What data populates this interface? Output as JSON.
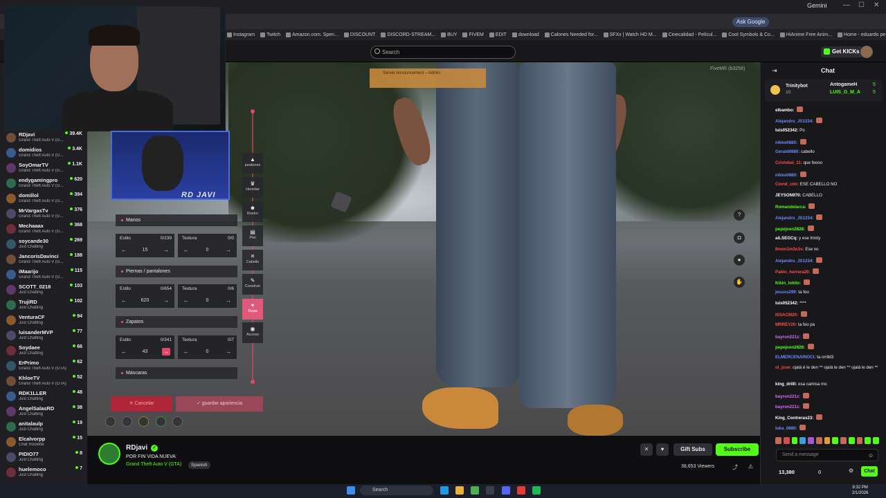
{
  "browser": {
    "gemini_label": "Gemini",
    "ask_google_label": "Ask Google",
    "bookmarks": [
      "Instagram",
      "Twitch",
      "Amazon.com. Spen...",
      "DISCOUNT",
      "DISCORD-STREAM...",
      "BUY",
      "FIVEM",
      "EDIT",
      "download",
      "Calones Needed for...",
      "SFXx | Watch HD M...",
      "Cinecalidad - Películ...",
      "Cool Symbols & Co...",
      "HiAnime Free Anim...",
      "Home - eduardo pe..."
    ]
  },
  "topnav": {
    "search_placeholder": "Search",
    "get_kicks_label": "Get KICKs"
  },
  "sidebar": {
    "channels": [
      {
        "name": "RDjavi",
        "game": "Grand Theft Auto V (G...",
        "viewers": "39.4K"
      },
      {
        "name": "domidios",
        "game": "Grand Theft Auto V (G...",
        "viewers": "3.4K"
      },
      {
        "name": "SoyOmarTV",
        "game": "Grand Theft Auto V (G...",
        "viewers": "1.1K"
      },
      {
        "name": "endygamingpro",
        "game": "Grand Theft Auto V (G...",
        "viewers": "620"
      },
      {
        "name": "domillol",
        "game": "Grand Theft Auto V (G...",
        "viewers": "394"
      },
      {
        "name": "MrVargasTv",
        "game": "Grand Theft Auto V (G...",
        "viewers": "376"
      },
      {
        "name": "Mechaaax",
        "game": "Grand Theft Auto V (G...",
        "viewers": "368"
      },
      {
        "name": "soycande30",
        "game": "Just Chatting",
        "viewers": "269"
      },
      {
        "name": "JancorisDavinci",
        "game": "Grand Theft Auto V (G...",
        "viewers": "188"
      },
      {
        "name": "iMaarijo",
        "game": "Grand Theft Auto V (G...",
        "viewers": "115"
      },
      {
        "name": "SCOTT_0218",
        "game": "Just Chatting",
        "viewers": "103"
      },
      {
        "name": "TrujiRD",
        "game": "Just Chatting",
        "viewers": "102"
      },
      {
        "name": "VenturaCF",
        "game": "Just Chatting",
        "viewers": "94"
      },
      {
        "name": "luisanderMVP",
        "game": "Just Chatting",
        "viewers": "77"
      },
      {
        "name": "Soydaee",
        "game": "Just Chatting",
        "viewers": "66"
      },
      {
        "name": "ErPrimo",
        "game": "Grand Theft Auto V (GTA)",
        "viewers": "62"
      },
      {
        "name": "KhloeTV",
        "game": "Grand Theft Auto V (GTA)",
        "viewers": "52"
      },
      {
        "name": "RDK1LLER",
        "game": "Just Chatting",
        "viewers": "48"
      },
      {
        "name": "AngelSalasRD",
        "game": "Just Chatting",
        "viewers": "38"
      },
      {
        "name": "anitalaulp",
        "game": "Just Chatting",
        "viewers": "19"
      },
      {
        "name": "Elcalvorpp",
        "game": "Chat Roulette",
        "viewers": "15"
      },
      {
        "name": "PIDIO77",
        "game": "Just Chatting",
        "viewers": "8"
      },
      {
        "name": "huelemoco",
        "game": "Just Chatting",
        "viewers": "7"
      }
    ]
  },
  "webcam": {
    "pip_label": "RD JAVI"
  },
  "game_ui": {
    "announcement": "Server Announcement – Admin:",
    "fivem_label": "FiveM® (b3258)",
    "truncated_value": "1425",
    "sections": {
      "manos": "Manos",
      "piernas": "Piernas / pantalones",
      "zapatos": "Zapatos",
      "mascaras": "Máscaras"
    },
    "labels": {
      "estilo": "Estilo",
      "textura": "Textura"
    },
    "manos": {
      "estilo_count": "0/239",
      "estilo_val": "15",
      "textura_count": "0/0",
      "textura_val": "0"
    },
    "piernas": {
      "estilo_count": "0/654",
      "estilo_val": "620",
      "textura_count": "0/6",
      "textura_val": "0"
    },
    "zapatos": {
      "estilo_count": "0/341",
      "estilo_val": "43",
      "textura_count": "0/7",
      "textura_val": "0"
    },
    "side_buttons": [
      {
        "icon": "▲",
        "label": "peatones"
      },
      {
        "icon": "♛",
        "label": "Heredar"
      },
      {
        "icon": "☻",
        "label": "Rostro"
      },
      {
        "icon": "▤",
        "label": "Piel"
      },
      {
        "icon": "✕",
        "label": "Cabello"
      },
      {
        "icon": "✎",
        "label": "Construir"
      },
      {
        "icon": "♥",
        "label": "Ropa"
      },
      {
        "icon": "◉",
        "label": "Acceso"
      }
    ],
    "cancel_label": "✕ Cancelar",
    "save_label": "✓ guardar apariencia"
  },
  "stream": {
    "streamer": "RDjavi",
    "title": "POR FIN VIDA NUEVA",
    "game": "Grand Theft Auto V (GTA)",
    "language": "Spanish",
    "viewers": "38,653 Viewers",
    "gift_subs_label": "Gift Subs",
    "subscribe_label": "Subscribe"
  },
  "chat": {
    "title": "Chat",
    "pinned": {
      "user1": "Trinitybot",
      "user1_count": "10",
      "user2": "AntogameH",
      "user3": "LUIS_G_M_A",
      "count": "5"
    },
    "messages": [
      {
        "user": "elbambo:",
        "text": "",
        "color": "#ffffff"
      },
      {
        "user": "Alejandro_JS1234:",
        "text": "",
        "color": "#6b8cff"
      },
      {
        "user": "luis052342:",
        "text": "Po",
        "color": "#ffffff"
      },
      {
        "user": "nikko0880:",
        "text": "",
        "color": "#6b8cff"
      },
      {
        "user": "Gerald0880:",
        "text": "cabello",
        "color": "#6b8cff"
      },
      {
        "user": "Cristobal_11:",
        "text": "que feooo",
        "color": "#ff4d4d"
      },
      {
        "user": "nikko0880:",
        "text": "",
        "color": "#6b8cff"
      },
      {
        "user": "Ciond_ctm:",
        "text": "ESE CABELLO NO",
        "color": "#ff4d4d"
      },
      {
        "user": "JEYSON970:",
        "text": "CABELLO",
        "color": "#ffffff"
      },
      {
        "user": "Romandelarca:",
        "text": "",
        "color": "#53fc18"
      },
      {
        "user": "Alejandro_JS1234:",
        "text": "",
        "color": "#6b8cff"
      },
      {
        "user": "pepejoen2828:",
        "text": "",
        "color": "#53fc18"
      },
      {
        "user": "aiLSEGCq:",
        "text": "y ese trinity",
        "color": "#ffffff"
      },
      {
        "user": "8mon1m3o3s:",
        "text": "Ese no",
        "color": "#ff4d4d"
      },
      {
        "user": "Alejandro_JS1234:",
        "text": "",
        "color": "#6b8cff"
      },
      {
        "user": "Pablo_herrera20:",
        "text": "",
        "color": "#ff4d4d"
      },
      {
        "user": "Kikin_lokito:",
        "text": "",
        "color": "#53fc18"
      },
      {
        "user": "jesuss299:",
        "text": "ta feo",
        "color": "#6b8cff"
      },
      {
        "user": "luis052342:",
        "text": "****",
        "color": "#ffffff"
      },
      {
        "user": "ISSACM20:",
        "text": "",
        "color": "#ff4d4d"
      },
      {
        "user": "MRREY20:",
        "text": "ta feo pa",
        "color": "#ff4d4d"
      },
      {
        "user": "bayron221z:",
        "text": "",
        "color": "#d36bff"
      },
      {
        "user": "pepejoen2828:",
        "text": "",
        "color": "#53fc18"
      },
      {
        "user": "ELMERCENARIOCI:",
        "text": "ta orribl3",
        "color": "#6b8cff"
      },
      {
        "user": "oi_jose:",
        "text": "ojalá é le den ** ojalá le den ** ojalá le den **",
        "color": "#ff4d4d"
      },
      {
        "user": "king_drilll:",
        "text": "esa camisa mo",
        "color": "#ffffff"
      },
      {
        "user": "bayron221z:",
        "text": "",
        "color": "#d36bff"
      },
      {
        "user": "bayron221z:",
        "text": "",
        "color": "#d36bff"
      },
      {
        "user": "King_Contreras23:",
        "text": "",
        "color": "#ffffff"
      },
      {
        "user": "luka_0880:",
        "text": "",
        "color": "#6b8cff"
      }
    ],
    "input_placeholder": "Send a message",
    "kicks_count": "13,380",
    "kicks_zero": "0",
    "send_label": "Chat"
  },
  "taskbar": {
    "search_label": "Search",
    "time": "8:32 PM",
    "date": "2/1/2026"
  }
}
